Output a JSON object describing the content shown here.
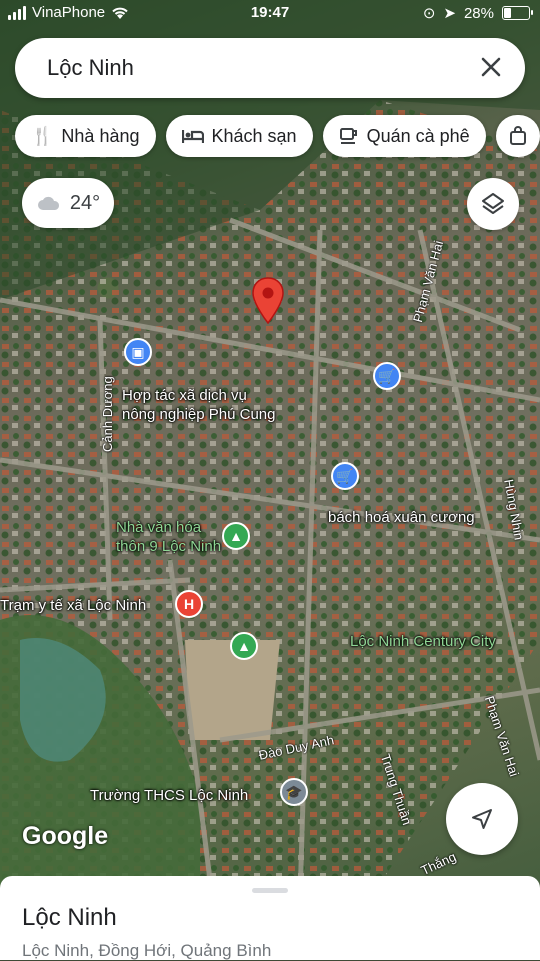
{
  "status_bar": {
    "carrier": "VinaPhone",
    "time": "19:47",
    "battery": "28%",
    "battery_level": 0.28
  },
  "search": {
    "query": "Lộc Ninh",
    "clear_icon": "close-icon"
  },
  "chips": [
    {
      "label": "Nhà hàng",
      "icon": "restaurant-icon"
    },
    {
      "label": "Khách sạn",
      "icon": "hotel-icon"
    },
    {
      "label": "Quán cà phê",
      "icon": "coffee-icon"
    },
    {
      "label": "",
      "icon": "shopping-bag-icon"
    }
  ],
  "weather": {
    "temp": "24°",
    "icon": "cloud-icon"
  },
  "map": {
    "pois": [
      {
        "name": "Hợp tác xã dịch vụ nông nghiệp Phú Cung",
        "line1": "Hợp tác xã dịch vụ",
        "line2": "nông nghiệp Phú Cung",
        "color": "#ffffff"
      },
      {
        "name": "bách hoá xuân cương",
        "color": "#ffffff"
      },
      {
        "name": "Nhà văn hóa thôn 9 Lộc Ninh",
        "line1": "Nhà văn hóa",
        "line2": "thôn 9 Lộc Ninh",
        "color": "#8fd694"
      },
      {
        "name": "Trạm y tế xã Lộc Ninh",
        "color": "#ffffff"
      },
      {
        "name": "Lộc Ninh Century City",
        "color": "#8fd694"
      },
      {
        "name": "Trường THCS Lộc Ninh",
        "color": "#ffffff"
      }
    ],
    "streets": [
      "Phạm Văn Hai",
      "Cảnh Dương",
      "Hùng Nhin",
      "Đào Duy Anh",
      "Trung Thuần",
      "Phạm Văn Hai",
      "Thắng"
    ],
    "logo": "Google"
  },
  "place_sheet": {
    "title": "Lộc Ninh",
    "address": "Lộc Ninh, Đồng Hới, Quảng Bình"
  },
  "colors": {
    "pin": "#ea4335",
    "shop": "#4285f4",
    "park": "#34a853",
    "hospital": "#ea4335",
    "school": "#7c8a96"
  }
}
